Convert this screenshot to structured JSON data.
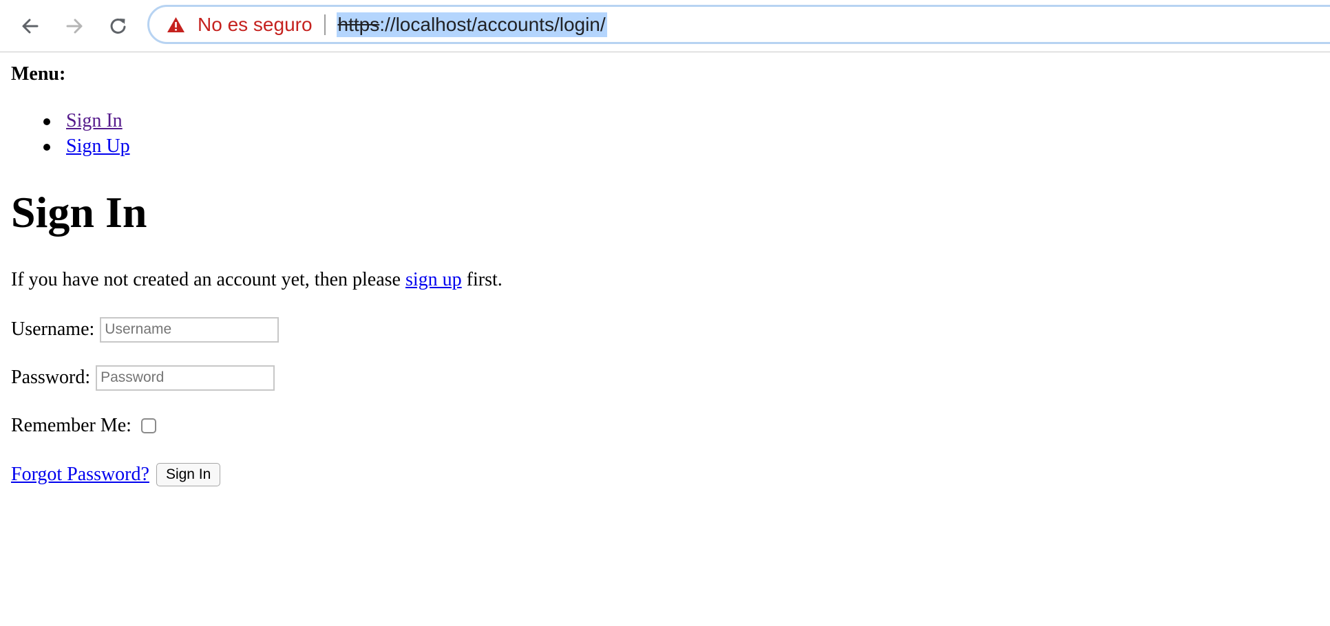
{
  "browser": {
    "security_label": "No es seguro",
    "url_scheme": "https",
    "url_rest": "://localhost/accounts/login/",
    "icons": {
      "back": "arrow-left-icon",
      "forward": "arrow-right-icon",
      "reload": "reload-icon",
      "warning": "warning-triangle-icon"
    },
    "colors": {
      "warning": "#c5221f",
      "url_selection": "#b4d5fd",
      "omnibox_focus": "#b7d3f2"
    }
  },
  "page": {
    "menu_label": "Menu:",
    "menu_items": [
      {
        "label": "Sign In",
        "visited": true
      },
      {
        "label": "Sign Up",
        "visited": false
      }
    ],
    "title": "Sign In",
    "intro_before": "If you have not created an account yet, then please ",
    "intro_link": "sign up",
    "intro_after": " first.",
    "username_label": "Username:",
    "username_placeholder": "Username",
    "username_value": "",
    "password_label": "Password:",
    "password_placeholder": "Password",
    "password_value": "",
    "remember_label": "Remember Me:",
    "remember_checked": false,
    "forgot_link": "Forgot Password?",
    "submit_label": "Sign In",
    "colors": {
      "link": "#0000ee",
      "visited_link": "#551a8b"
    }
  }
}
